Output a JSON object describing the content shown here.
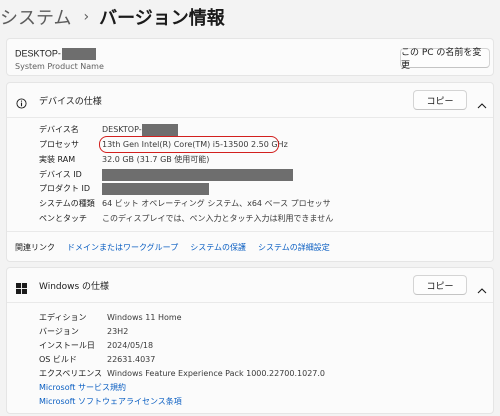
{
  "breadcrumb": {
    "parent": "システム",
    "separator": "›",
    "current": "バージョン情報"
  },
  "device_card": {
    "name_prefix": "DESKTOP-",
    "subtitle": "System Product Name",
    "rename_button": "この PC の名前を変更"
  },
  "device_spec": {
    "title": "デバイスの仕様",
    "copy_button": "コピー",
    "rows": {
      "device_name": {
        "key": "デバイス名",
        "value": "DESKTOP-"
      },
      "processor": {
        "key": "プロセッサ",
        "value": "13th Gen Intel(R) Core(TM) i5-13500   2.50 GHz"
      },
      "ram": {
        "key": "実装 RAM",
        "value": "32.0 GB (31.7 GB 使用可能)"
      },
      "device_id": {
        "key": "デバイス ID",
        "value": ""
      },
      "product_id": {
        "key": "プロダクト ID",
        "value": ""
      },
      "system_type": {
        "key": "システムの種類",
        "value": "64 ビット オペレーティング システム、x64 ベース プロセッサ"
      },
      "pen_touch": {
        "key": "ペンとタッチ",
        "value": "このディスプレイでは、ペン入力とタッチ入力は利用できません"
      }
    },
    "related_label": "関連リンク",
    "related_links": {
      "domain": "ドメインまたはワークグループ",
      "protection": "システムの保護",
      "advanced": "システムの詳細設定"
    }
  },
  "windows_spec": {
    "title": "Windows の仕様",
    "copy_button": "コピー",
    "rows": {
      "edition": {
        "key": "エディション",
        "value": "Windows 11 Home"
      },
      "version": {
        "key": "バージョン",
        "value": "23H2"
      },
      "install_date": {
        "key": "インストール日",
        "value": "2024/05/18"
      },
      "os_build": {
        "key": "OS ビルド",
        "value": "22631.4037"
      },
      "experience": {
        "key": "エクスペリエンス",
        "value": "Windows Feature Experience Pack 1000.22700.1027.0"
      }
    },
    "links": {
      "services": "Microsoft サービス規約",
      "license": "Microsoft ソフトウェアライセンス条項"
    }
  },
  "colors": {
    "accent_link": "#0a5ec2",
    "highlight": "#d2201e",
    "redaction": "#6e6e6e"
  },
  "icons": {
    "device_spec": "info-icon",
    "windows_spec": "windows-logo-icon"
  }
}
